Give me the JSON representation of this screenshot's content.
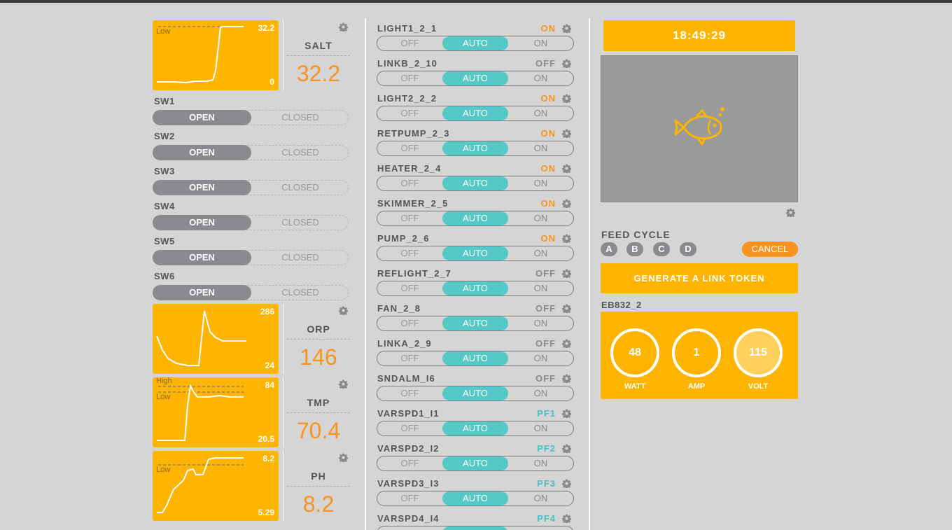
{
  "probes": [
    {
      "name": "SALT",
      "value": "32.2",
      "max": "32.2",
      "min": "0",
      "low_label": "Low",
      "high_label": ""
    },
    {
      "name": "ORP",
      "value": "146",
      "max": "286",
      "min": "24",
      "low_label": "",
      "high_label": ""
    },
    {
      "name": "TMP",
      "value": "70.4",
      "max": "84",
      "min": "20.5",
      "low_label": "Low",
      "high_label": "High"
    },
    {
      "name": "PH",
      "value": "8.2",
      "max": "8.2",
      "min": "5.29",
      "low_label": "Low",
      "high_label": ""
    }
  ],
  "switches": [
    {
      "name": "SW1",
      "open_label": "OPEN",
      "closed_label": "CLOSED"
    },
    {
      "name": "SW2",
      "open_label": "OPEN",
      "closed_label": "CLOSED"
    },
    {
      "name": "SW3",
      "open_label": "OPEN",
      "closed_label": "CLOSED"
    },
    {
      "name": "SW4",
      "open_label": "OPEN",
      "closed_label": "CLOSED"
    },
    {
      "name": "SW5",
      "open_label": "OPEN",
      "closed_label": "CLOSED"
    },
    {
      "name": "SW6",
      "open_label": "OPEN",
      "closed_label": "CLOSED"
    }
  ],
  "outlet_modes": {
    "off": "OFF",
    "auto": "AUTO",
    "on": "ON"
  },
  "outlets": [
    {
      "name": "LIGHT1_2_1",
      "state": "ON"
    },
    {
      "name": "LINKB_2_10",
      "state": "OFF"
    },
    {
      "name": "LIGHT2_2_2",
      "state": "ON"
    },
    {
      "name": "RETPUMP_2_3",
      "state": "ON"
    },
    {
      "name": "HEATER_2_4",
      "state": "ON"
    },
    {
      "name": "SKIMMER_2_5",
      "state": "ON"
    },
    {
      "name": "PUMP_2_6",
      "state": "ON"
    },
    {
      "name": "REFLIGHT_2_7",
      "state": "OFF"
    },
    {
      "name": "FAN_2_8",
      "state": "OFF"
    },
    {
      "name": "LINKA_2_9",
      "state": "OFF"
    },
    {
      "name": "SNDALM_I6",
      "state": "OFF"
    },
    {
      "name": "VARSPD1_I1",
      "state": "PF1"
    },
    {
      "name": "VARSPD2_I2",
      "state": "PF2"
    },
    {
      "name": "VARSPD3_I3",
      "state": "PF3"
    },
    {
      "name": "VARSPD4_I4",
      "state": "PF4"
    }
  ],
  "clock": "18:49:29",
  "feed": {
    "label": "FEED CYCLE",
    "buttons": [
      "A",
      "B",
      "C",
      "D"
    ],
    "cancel": "CANCEL"
  },
  "generate_token": "GENERATE A LINK TOKEN",
  "energy_bar": {
    "name": "EB832_2",
    "watt": "48",
    "watt_label": "WATT",
    "amp": "1",
    "amp_label": "AMP",
    "volt": "115",
    "volt_label": "VOLT"
  },
  "colors": {
    "accent": "#ffb400",
    "on": "#f7931e",
    "auto": "#55c8c8",
    "pf": "#44c2c2",
    "background": "#d5d5d5"
  },
  "icons": {
    "gear": "gear-icon",
    "fish": "fish-icon"
  }
}
